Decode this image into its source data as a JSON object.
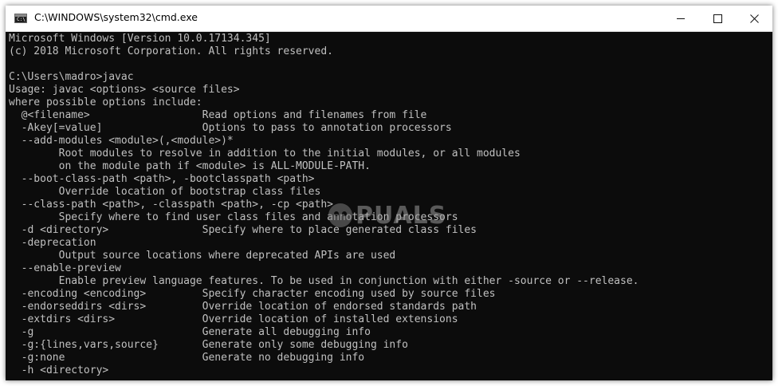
{
  "window": {
    "title": "C:\\WINDOWS\\system32\\cmd.exe",
    "icon": "cmd-icon",
    "controls": {
      "minimize": "minimize-icon",
      "maximize": "maximize-icon",
      "close": "close-icon"
    }
  },
  "console": {
    "lines": [
      "Microsoft Windows [Version 10.0.17134.345]",
      "(c) 2018 Microsoft Corporation. All rights reserved.",
      "",
      "C:\\Users\\madro>javac",
      "Usage: javac <options> <source files>",
      "where possible options include:",
      "  @<filename>                  Read options and filenames from file",
      "  -Akey[=value]                Options to pass to annotation processors",
      "  --add-modules <module>(,<module>)*",
      "        Root modules to resolve in addition to the initial modules, or all modules",
      "        on the module path if <module> is ALL-MODULE-PATH.",
      "  --boot-class-path <path>, -bootclasspath <path>",
      "        Override location of bootstrap class files",
      "  --class-path <path>, -classpath <path>, -cp <path>",
      "        Specify where to find user class files and annotation processors",
      "  -d <directory>               Specify where to place generated class files",
      "  -deprecation",
      "        Output source locations where deprecated APIs are used",
      "  --enable-preview",
      "        Enable preview language features. To be used in conjunction with either -source or --release.",
      "  -encoding <encoding>         Specify character encoding used by source files",
      "  -endorseddirs <dirs>         Override location of endorsed standards path",
      "  -extdirs <dirs>              Override location of installed extensions",
      "  -g                           Generate all debugging info",
      "  -g:{lines,vars,source}       Generate only some debugging info",
      "  -g:none                      Generate no debugging info",
      "  -h <directory>"
    ]
  },
  "watermark": {
    "text": "PUALS",
    "logo": "appuals-logo"
  },
  "colors": {
    "console_bg": "#0c0c0c",
    "console_fg": "#c0c0c0",
    "titlebar_bg": "#ffffff"
  }
}
